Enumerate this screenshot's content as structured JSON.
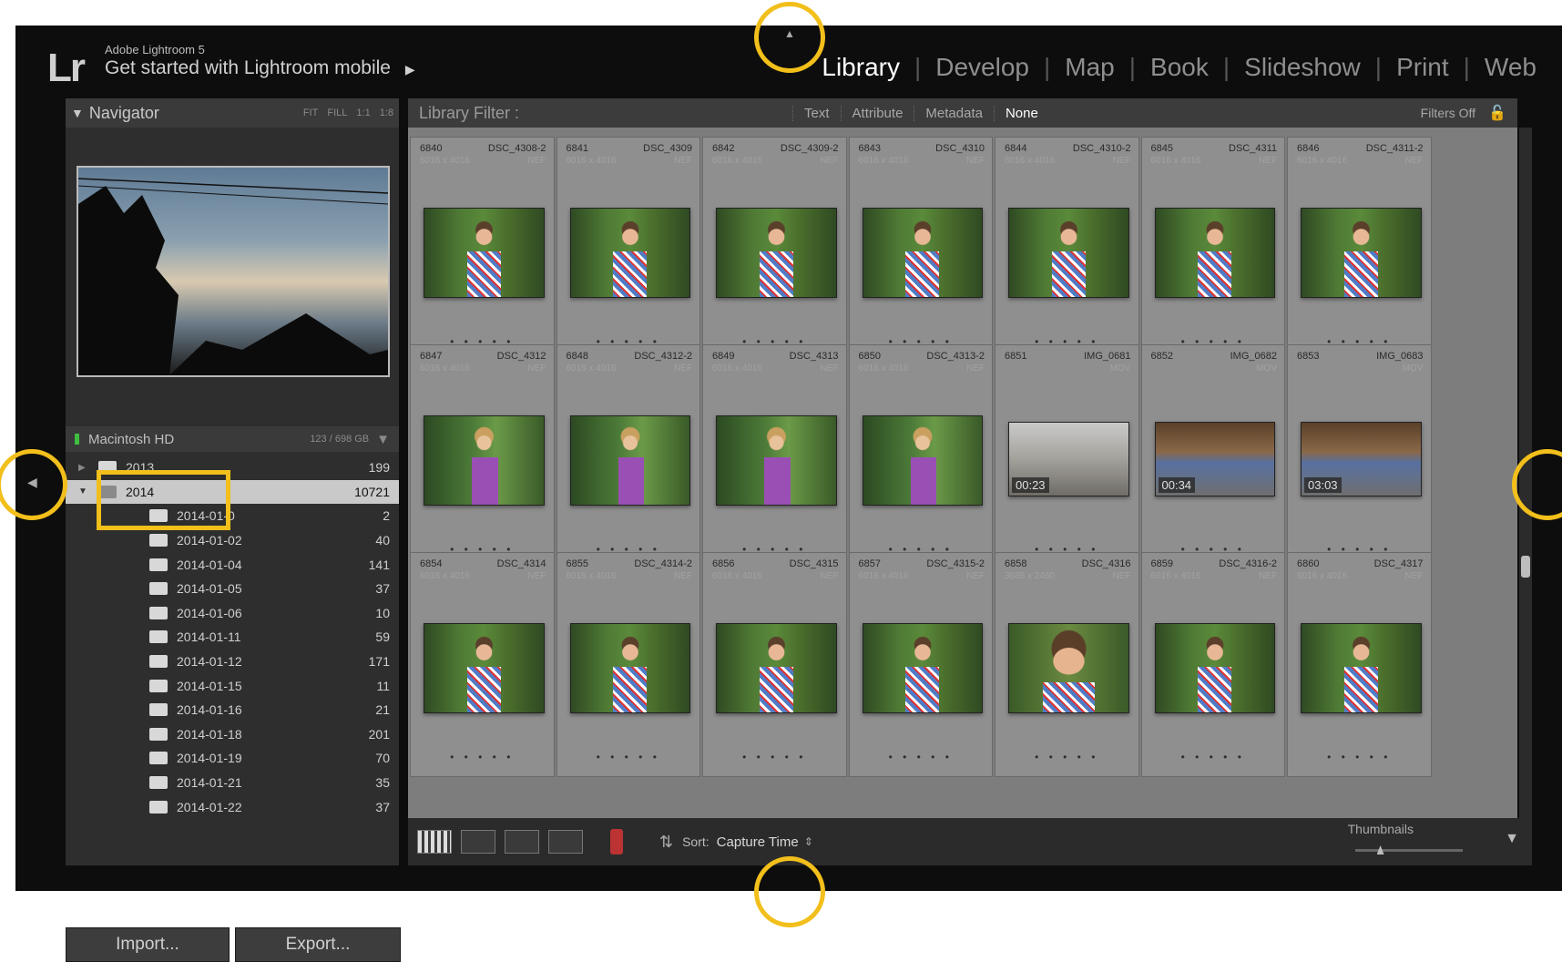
{
  "header": {
    "app_name": "Adobe Lightroom 5",
    "mobile_prompt": "Get started with Lightroom mobile",
    "modules": [
      "Library",
      "Develop",
      "Map",
      "Book",
      "Slideshow",
      "Print",
      "Web"
    ],
    "active_module": "Library"
  },
  "navigator": {
    "title": "Navigator",
    "zoom_options": [
      "FIT",
      "FILL",
      "1:1",
      "1:8"
    ]
  },
  "folders_panel": {
    "drive_name": "Macintosh HD",
    "drive_usage": "123 / 698 GB",
    "folders": [
      {
        "name": "2013",
        "count": "199",
        "level": 0
      },
      {
        "name": "2014",
        "count": "10721",
        "level": 0,
        "selected": true
      },
      {
        "name": "2014-01-0",
        "count": "2",
        "level": 1
      },
      {
        "name": "2014-01-02",
        "count": "40",
        "level": 1
      },
      {
        "name": "2014-01-04",
        "count": "141",
        "level": 1
      },
      {
        "name": "2014-01-05",
        "count": "37",
        "level": 1
      },
      {
        "name": "2014-01-06",
        "count": "10",
        "level": 1
      },
      {
        "name": "2014-01-11",
        "count": "59",
        "level": 1
      },
      {
        "name": "2014-01-12",
        "count": "171",
        "level": 1
      },
      {
        "name": "2014-01-15",
        "count": "11",
        "level": 1
      },
      {
        "name": "2014-01-16",
        "count": "21",
        "level": 1
      },
      {
        "name": "2014-01-18",
        "count": "201",
        "level": 1
      },
      {
        "name": "2014-01-19",
        "count": "70",
        "level": 1
      },
      {
        "name": "2014-01-21",
        "count": "35",
        "level": 1
      },
      {
        "name": "2014-01-22",
        "count": "37",
        "level": 1
      }
    ],
    "import_label": "Import...",
    "export_label": "Export..."
  },
  "filter_bar": {
    "label": "Library Filter :",
    "options": [
      "Text",
      "Attribute",
      "Metadata",
      "None"
    ],
    "active_option": "None",
    "filters_status": "Filters Off"
  },
  "grid": {
    "rows": [
      [
        {
          "index": "6840",
          "name": "DSC_4308-2",
          "dims": "6016 x 4016",
          "ext": "NEF",
          "kind": "boy"
        },
        {
          "index": "6841",
          "name": "DSC_4309",
          "dims": "6016 x 4016",
          "ext": "NEF",
          "kind": "boy"
        },
        {
          "index": "6842",
          "name": "DSC_4309-2",
          "dims": "6016 x 4016",
          "ext": "NEF",
          "kind": "boy"
        },
        {
          "index": "6843",
          "name": "DSC_4310",
          "dims": "6016 x 4016",
          "ext": "NEF",
          "kind": "boy"
        },
        {
          "index": "6844",
          "name": "DSC_4310-2",
          "dims": "6016 x 4016",
          "ext": "NEF",
          "kind": "boy"
        },
        {
          "index": "6845",
          "name": "DSC_4311",
          "dims": "6016 x 4016",
          "ext": "NEF",
          "kind": "boy"
        },
        {
          "index": "6846",
          "name": "DSC_4311-2",
          "dims": "6016 x 4016",
          "ext": "NEF",
          "kind": "boy"
        }
      ],
      [
        {
          "index": "6847",
          "name": "DSC_4312",
          "dims": "6016 x 4016",
          "ext": "NEF",
          "kind": "girl"
        },
        {
          "index": "6848",
          "name": "DSC_4312-2",
          "dims": "6016 x 4016",
          "ext": "NEF",
          "kind": "girl"
        },
        {
          "index": "6849",
          "name": "DSC_4313",
          "dims": "6016 x 4016",
          "ext": "NEF",
          "kind": "girl"
        },
        {
          "index": "6850",
          "name": "DSC_4313-2",
          "dims": "6016 x 4016",
          "ext": "NEF",
          "kind": "girl"
        },
        {
          "index": "6851",
          "name": "IMG_0681",
          "dims": "",
          "ext": "MOV",
          "kind": "video1",
          "duration": "00:23"
        },
        {
          "index": "6852",
          "name": "IMG_0682",
          "dims": "",
          "ext": "MOV",
          "kind": "video2",
          "duration": "00:34"
        },
        {
          "index": "6853",
          "name": "IMG_0683",
          "dims": "",
          "ext": "MOV",
          "kind": "video2",
          "duration": "03:03"
        }
      ],
      [
        {
          "index": "6854",
          "name": "DSC_4314",
          "dims": "6016 x 4016",
          "ext": "NEF",
          "kind": "boy"
        },
        {
          "index": "6855",
          "name": "DSC_4314-2",
          "dims": "6016 x 4016",
          "ext": "NEF",
          "kind": "boy"
        },
        {
          "index": "6856",
          "name": "DSC_4315",
          "dims": "6016 x 4016",
          "ext": "NEF",
          "kind": "boy"
        },
        {
          "index": "6857",
          "name": "DSC_4315-2",
          "dims": "6016 x 4016",
          "ext": "NEF",
          "kind": "boy"
        },
        {
          "index": "6858",
          "name": "DSC_4316",
          "dims": "3685 x 2460",
          "ext": "NEF",
          "kind": "boyclose"
        },
        {
          "index": "6859",
          "name": "DSC_4316-2",
          "dims": "6016 x 4016",
          "ext": "NEF",
          "kind": "boy"
        },
        {
          "index": "6860",
          "name": "DSC_4317",
          "dims": "6016 x 4016",
          "ext": "NEF",
          "kind": "boy"
        }
      ]
    ]
  },
  "toolbar": {
    "sort_label": "Sort:",
    "sort_value": "Capture Time",
    "thumbnails_label": "Thumbnails",
    "thumbnail_size": 0.2
  },
  "colors": {
    "annotation": "#f2bf1b",
    "background": "#0d0d0d",
    "grid": "#7d7d7d"
  }
}
